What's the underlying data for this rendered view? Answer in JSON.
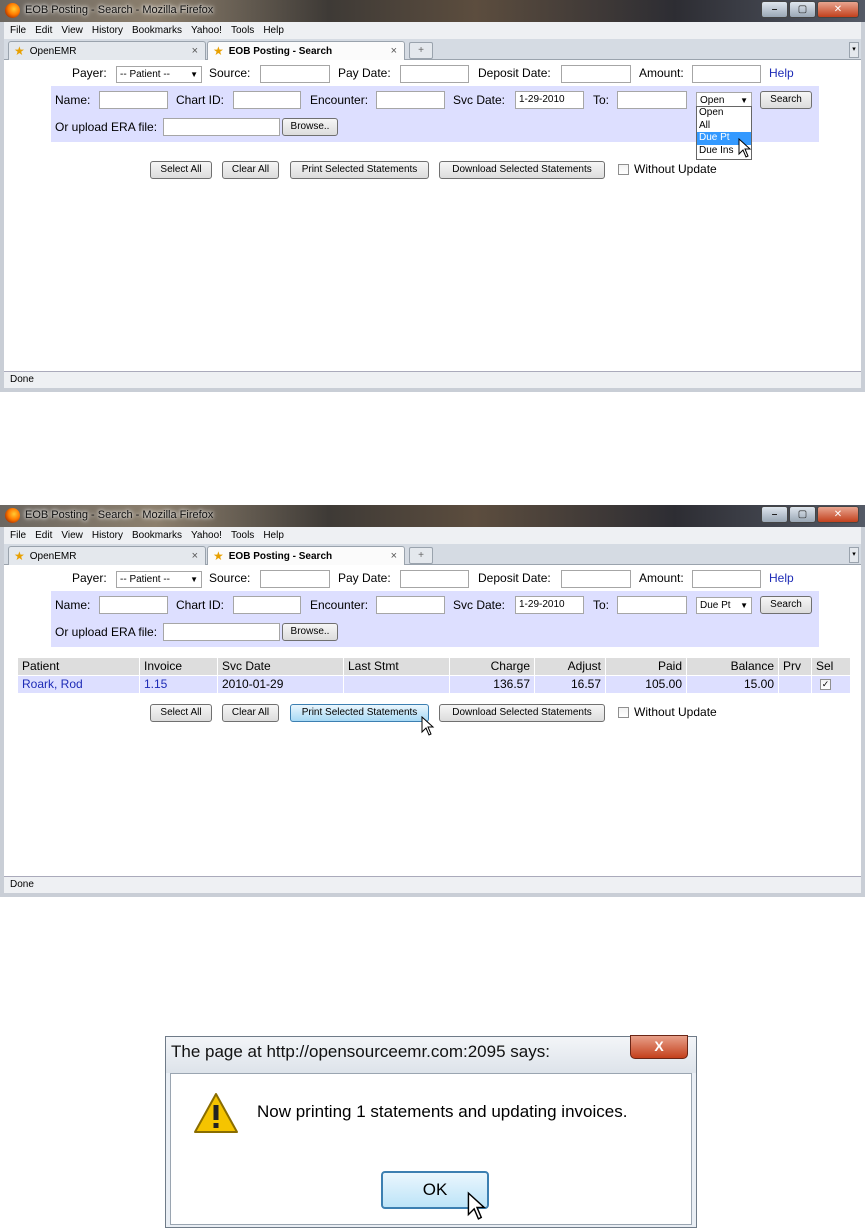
{
  "browser": {
    "window_title": "EOB Posting - Search - Mozilla Firefox",
    "menu": [
      "File",
      "Edit",
      "View",
      "History",
      "Bookmarks",
      "Yahoo!",
      "Tools",
      "Help"
    ],
    "tabs": [
      {
        "label": "OpenEMR",
        "close": "×"
      },
      {
        "label": "EOB Posting - Search",
        "close": "×"
      }
    ],
    "new_tab": "+",
    "status": "Done"
  },
  "form": {
    "payer_label": "Payer:",
    "payer_value": "-- Patient --",
    "source_label": "Source:",
    "pay_date_label": "Pay Date:",
    "deposit_date_label": "Deposit Date:",
    "amount_label": "Amount:",
    "help_link": "Help",
    "name_label": "Name:",
    "chart_id_label": "Chart ID:",
    "encounter_label": "Encounter:",
    "svc_date_label": "Svc Date:",
    "svc_date_value": "1-29-2010",
    "to_label": "To:",
    "search_button": "Search",
    "upload_label": "Or upload ERA file:",
    "browse_button": "Browse..",
    "select_all": "Select All",
    "clear_all": "Clear All",
    "print_statements": "Print Selected Statements",
    "download_statements": "Download Selected Statements",
    "without_update": "Without Update"
  },
  "screen1": {
    "status_select_value": "Open",
    "dropdown_options": [
      "Open",
      "All",
      "Due Pt",
      "Due Ins"
    ],
    "dropdown_highlighted": "Due Pt"
  },
  "screen2": {
    "status_select_value": "Due Pt",
    "table": {
      "headers": [
        "Patient",
        "Invoice",
        "Svc Date",
        "Last Stmt",
        "Charge",
        "Adjust",
        "Paid",
        "Balance",
        "Prv",
        "Sel"
      ],
      "rows": [
        {
          "patient": "Roark, Rod",
          "invoice": "1.15",
          "svc_date": "2010-01-29",
          "last_stmt": "",
          "charge": "136.57",
          "adjust": "16.57",
          "paid": "105.00",
          "balance": "15.00",
          "prv": "",
          "sel": "✓"
        }
      ]
    }
  },
  "dialog": {
    "title": "The page at http://opensourceemr.com:2095 says:",
    "close": "X",
    "message": "Now printing 1 statements and updating invoices.",
    "ok": "OK"
  },
  "colors": {
    "band": "#dddfff",
    "header_cell": "#dddddd",
    "link": "#1d2bb6",
    "highlight": "#3399ff"
  }
}
